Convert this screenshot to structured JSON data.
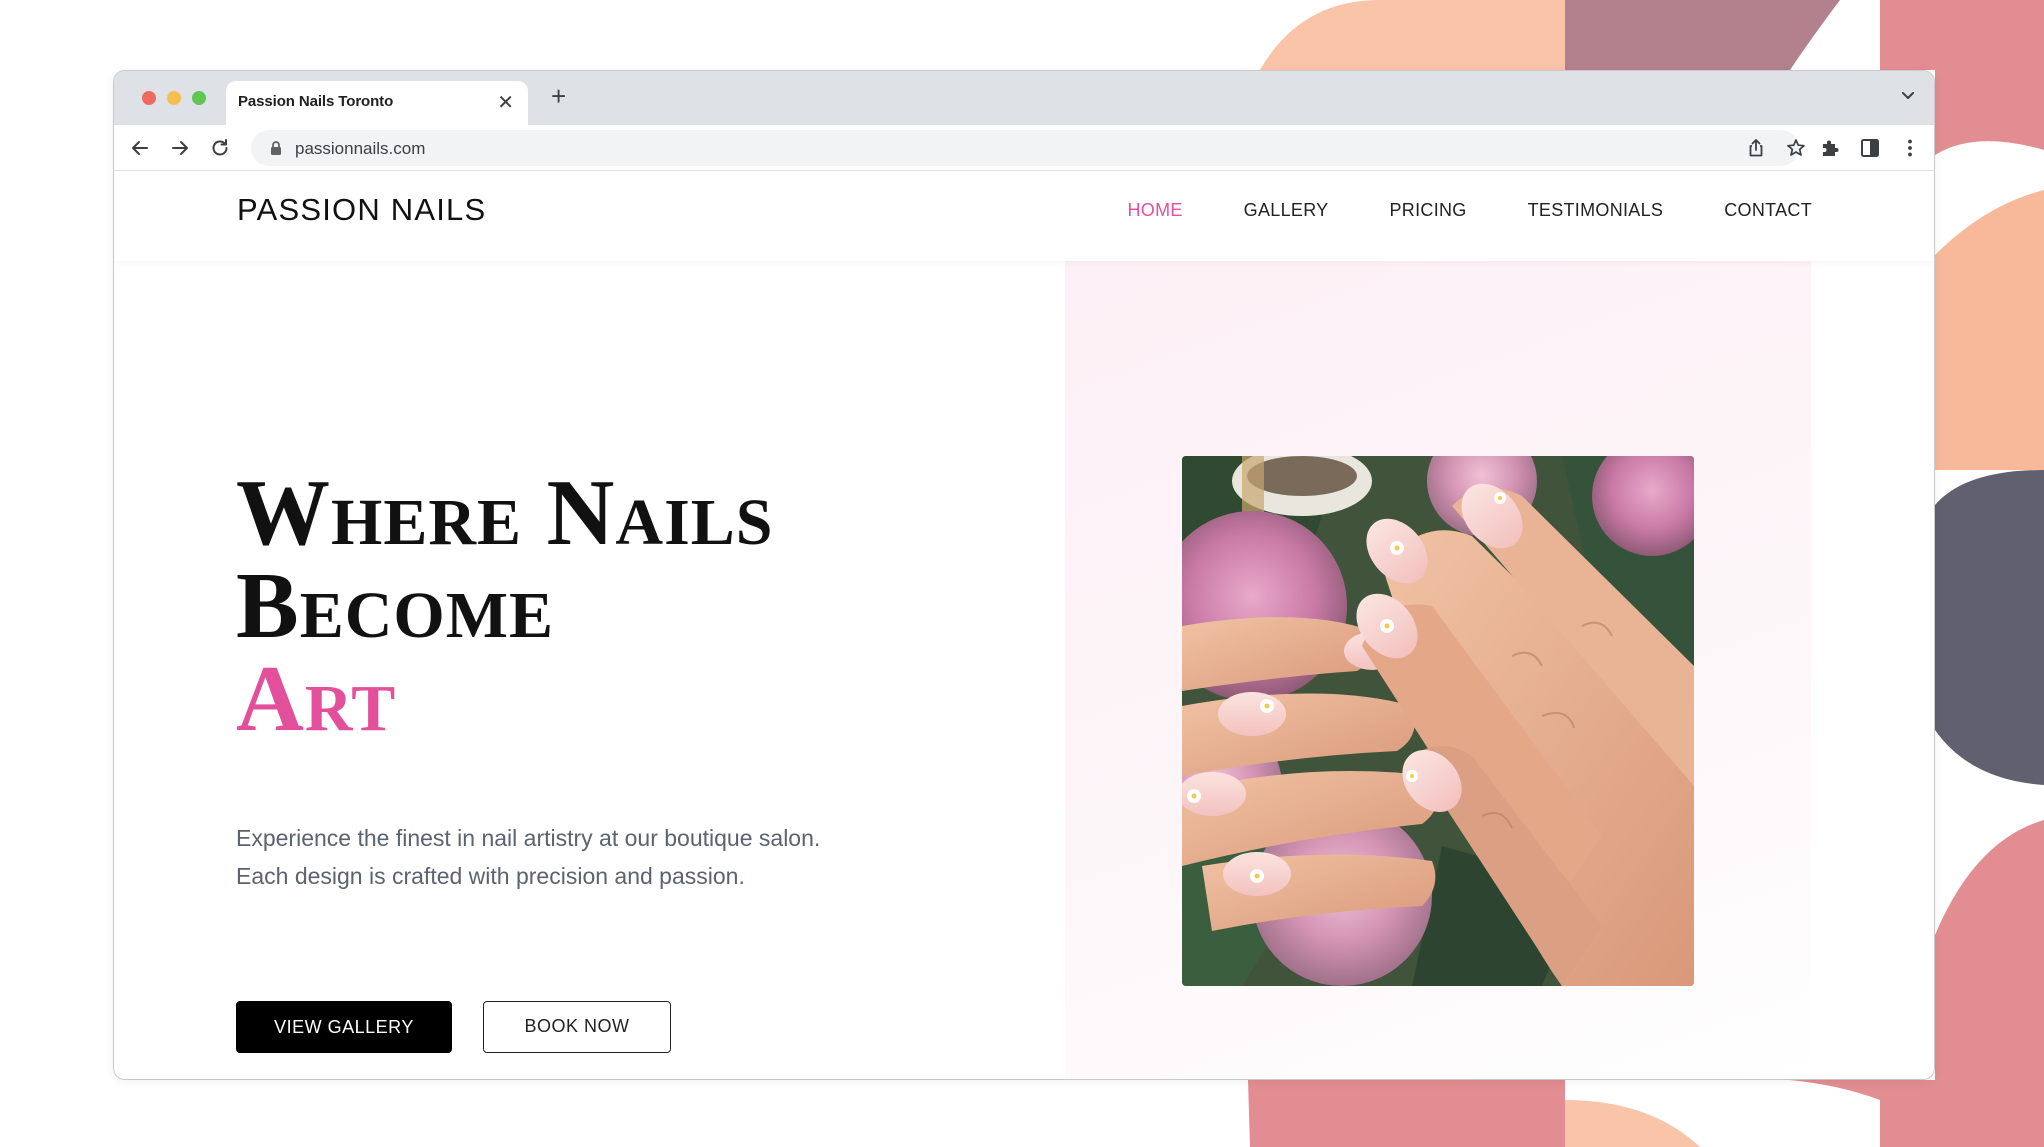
{
  "background": {
    "colors": [
      "#f9c4a8",
      "#b3808d",
      "#e28d91",
      "#60606e",
      "#f7b99a"
    ]
  },
  "browser": {
    "tab": {
      "title": "Passion Nails Toronto",
      "close_icon": "close-icon"
    },
    "new_tab_icon": "plus-icon",
    "address": {
      "url": "passionnails.com"
    }
  },
  "site": {
    "brand": "PASSION NAILS",
    "nav": [
      {
        "label": "HOME",
        "active": true
      },
      {
        "label": "GALLERY",
        "active": false
      },
      {
        "label": "PRICING",
        "active": false
      },
      {
        "label": "TESTIMONIALS",
        "active": false
      },
      {
        "label": "CONTACT",
        "active": false
      }
    ],
    "accent_color": "#e2509c"
  },
  "hero": {
    "headline_line1": "Where Nails",
    "headline_line2": "Become",
    "headline_accent": "Art",
    "description": "Experience the finest in nail artistry at our boutique salon. Each design is crafted with precision and passion.",
    "primary_button": "VIEW GALLERY",
    "secondary_button": "BOOK NOW",
    "image": "manicured-hands-with-hydrangeas"
  }
}
